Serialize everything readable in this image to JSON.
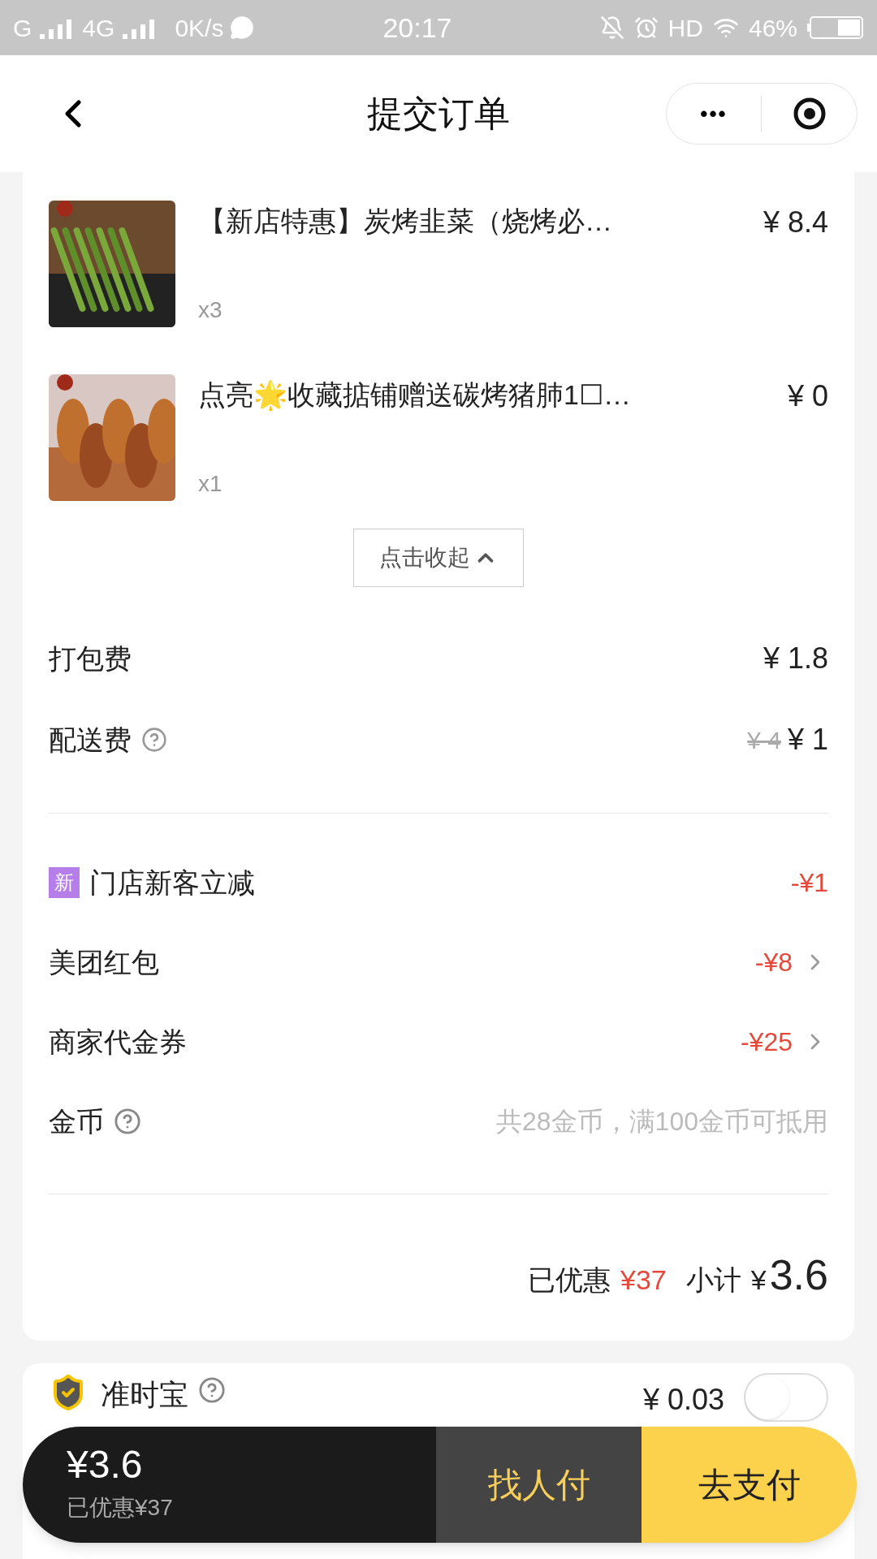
{
  "status_bar": {
    "network_1": "G",
    "network_2": "4G",
    "speed": "0K/s",
    "time": "20:17",
    "hd": "HD",
    "battery": "46%"
  },
  "nav": {
    "title": "提交订单",
    "more": "•••"
  },
  "items": [
    {
      "kind": "picture",
      "name": "【新店特惠】炭烤韭菜（烧烤必…",
      "price": "¥ 8.4",
      "qty": "x3"
    },
    {
      "kind": "picture",
      "name": "点亮🌟收藏掂铺赠送碳烤猪肺1☐…",
      "price": "¥ 0",
      "qty": "x1"
    }
  ],
  "collapse_button": "点击收起",
  "fees": [
    {
      "kind": "plain",
      "label": "打包费",
      "price": "¥ 1.8"
    },
    {
      "kind": "help",
      "label": "配送费",
      "old_price": "¥ 4",
      "price": "¥ 1"
    }
  ],
  "discounts": [
    {
      "kind": "badge",
      "badge": "新",
      "label": "门店新客立减",
      "value": "-¥1"
    },
    {
      "kind": "link",
      "label": "美团红包",
      "value": "-¥8"
    },
    {
      "kind": "link",
      "label": "商家代金券",
      "value": "-¥25"
    },
    {
      "kind": "help",
      "label": "金币",
      "value": "共28金币，满100金币可抵用"
    }
  ],
  "summary": {
    "saved_label": "已优惠",
    "saved": "¥37",
    "subtotal_label": "小计",
    "currency": "¥",
    "subtotal": "3.6"
  },
  "insurance": {
    "label": "准时宝",
    "price": "¥ 0.03",
    "on": false
  },
  "pay_bar": {
    "total": "¥3.6",
    "saved": "已优惠¥37",
    "friend_pay": "找人付",
    "pay": "去支付"
  }
}
